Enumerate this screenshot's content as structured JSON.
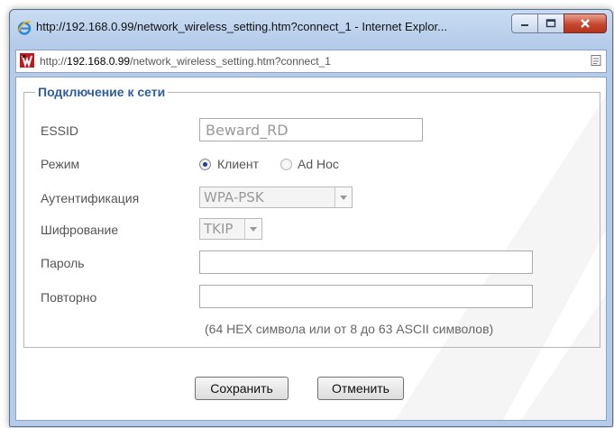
{
  "window": {
    "title": "http://192.168.0.99/network_wireless_setting.htm?connect_1 - Internet Explor...",
    "controls": {
      "minimize": "minimize",
      "maximize": "maximize",
      "close": "close"
    }
  },
  "address_bar": {
    "scheme": "http://",
    "host": "192.168.0.99",
    "path": "/network_wireless_setting.htm?connect_1"
  },
  "form": {
    "legend": "Подключение к сети",
    "essid": {
      "label": "ESSID",
      "value": "Beward_RD"
    },
    "mode": {
      "label": "Режим",
      "options": [
        {
          "label": "Клиент",
          "selected": true
        },
        {
          "label": "Ad Hoc",
          "selected": false
        }
      ]
    },
    "authentication": {
      "label": "Аутентификация",
      "value": "WPA-PSK"
    },
    "encryption": {
      "label": "Шифрование",
      "value": "TKIP"
    },
    "password": {
      "label": "Пароль",
      "value": ""
    },
    "repeat": {
      "label": "Повторно",
      "value": ""
    },
    "hint": "(64 HEX символа или от 8 до 63 ASCII символов)"
  },
  "buttons": {
    "save": "Сохранить",
    "cancel": "Отменить"
  }
}
